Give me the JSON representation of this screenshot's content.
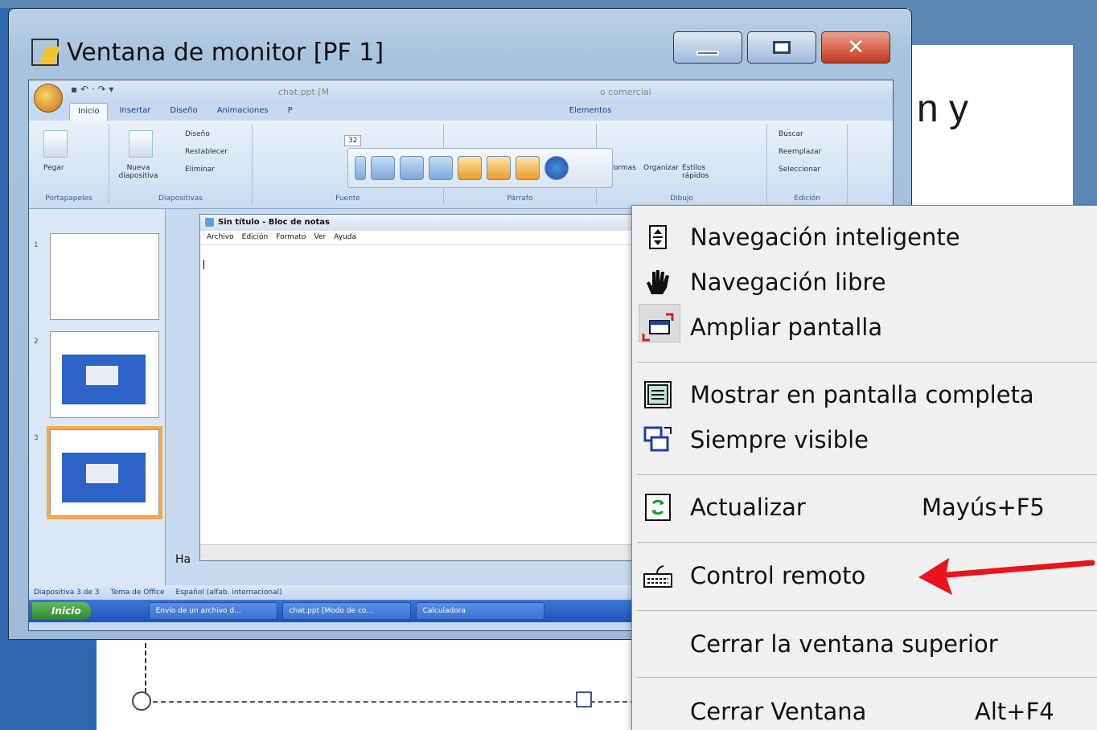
{
  "window": {
    "title": "Ventana de monitor [PF 1]",
    "controls": {
      "minimize": "minimize",
      "maximize": "maximize",
      "close": "✕"
    }
  },
  "background": {
    "slide_text": "n y"
  },
  "powerpoint": {
    "doc_title": "chat.ppt [M",
    "doc_title_suffix": "o comercial",
    "tabs": [
      "Inicio",
      "Insertar",
      "Diseño",
      "Animaciones",
      "P",
      "Elementos"
    ],
    "ribbon_groups": [
      "Portapapeles",
      "Diapositivas",
      "Fuente",
      "Párrafo",
      "Dibujo",
      "Edición"
    ],
    "ribbon_items": {
      "paste": "Pegar",
      "new_slide": "Nueva diapositiva",
      "layout": "Diseño",
      "reset": "Restablecer",
      "delete": "Eliminar",
      "shapes": "Formas",
      "arrange": "Organizar",
      "quick_styles": "Estilos rápidos",
      "find": "Buscar",
      "replace": "Reemplazar",
      "select": "Seleccionar",
      "font_size": "32"
    },
    "slides": [
      "1",
      "2",
      "3"
    ],
    "status": {
      "slide_info": "Diapositiva 3 de 3",
      "theme": "Tema de Office",
      "language": "Español (alfab. internacional)"
    },
    "partial_text": "Ha"
  },
  "notepad": {
    "title": "Sin título - Bloc de notas",
    "menu": [
      "Archivo",
      "Edición",
      "Formato",
      "Ver",
      "Ayuda"
    ]
  },
  "taskbar": {
    "start": "Inicio",
    "tasks": [
      "Envío de un archivo d...",
      "chat.ppt [Modo de co...",
      "Calculadora"
    ]
  },
  "context_menu": {
    "items": [
      {
        "label": "Navegación inteligente",
        "icon": "smart-navigation-icon"
      },
      {
        "label": "Navegación libre",
        "icon": "hand-icon"
      },
      {
        "label": "Ampliar pantalla",
        "icon": "enlarge-screen-icon"
      },
      {
        "label": "Mostrar en pantalla completa",
        "icon": "fullscreen-icon"
      },
      {
        "label": "Siempre visible",
        "icon": "always-on-top-icon"
      },
      {
        "label": "Actualizar",
        "icon": "refresh-icon",
        "shortcut": "Mayús+F5"
      },
      {
        "label": "Control remoto",
        "icon": "keyboard-icon"
      },
      {
        "label": "Cerrar la ventana superior"
      },
      {
        "label": "Cerrar Ventana",
        "shortcut": "Alt+F4"
      }
    ]
  },
  "colors": {
    "arrow": "#e8131b",
    "menu_bg": "#f0f0f0",
    "title_bar": "#a8c3de"
  }
}
